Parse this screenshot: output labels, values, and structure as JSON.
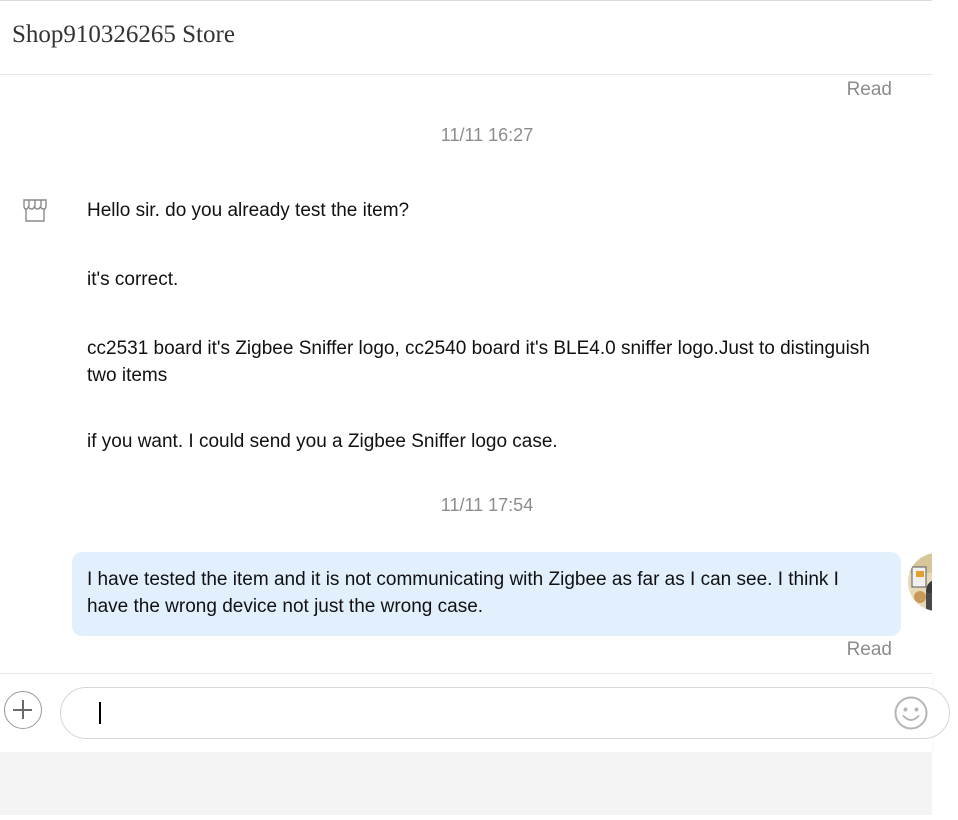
{
  "header": {
    "store_name": "Shop910326265 Store"
  },
  "messages": [
    {
      "type": "status",
      "text": "Read"
    },
    {
      "type": "timestamp",
      "text": "11/11 16:27"
    },
    {
      "type": "incoming",
      "text": "Hello sir. do you already test the item?"
    },
    {
      "type": "incoming",
      "text": "it's correct."
    },
    {
      "type": "incoming",
      "text": "cc2531 board it's Zigbee Sniffer logo, cc2540 board it's BLE4.0 sniffer logo.Just to distinguish two items"
    },
    {
      "type": "incoming",
      "text": "if you want. I could send you a Zigbee Sniffer logo case."
    },
    {
      "type": "timestamp",
      "text": "11/11 17:54"
    },
    {
      "type": "outgoing",
      "text": "I have tested the item and it is not communicating with Zigbee as far as I can see. I think I have the wrong device not just the wrong case."
    },
    {
      "type": "status",
      "text": "Read"
    }
  ],
  "input": {
    "value": "",
    "placeholder": ""
  },
  "icons": {
    "store_avatar": "storefront-icon",
    "user_avatar": "user-avatar-photo",
    "attach": "plus-icon",
    "emoji": "smiley-icon"
  },
  "colors": {
    "outgoing_bubble": "#e2effd",
    "muted_text": "#8c8c8c"
  }
}
